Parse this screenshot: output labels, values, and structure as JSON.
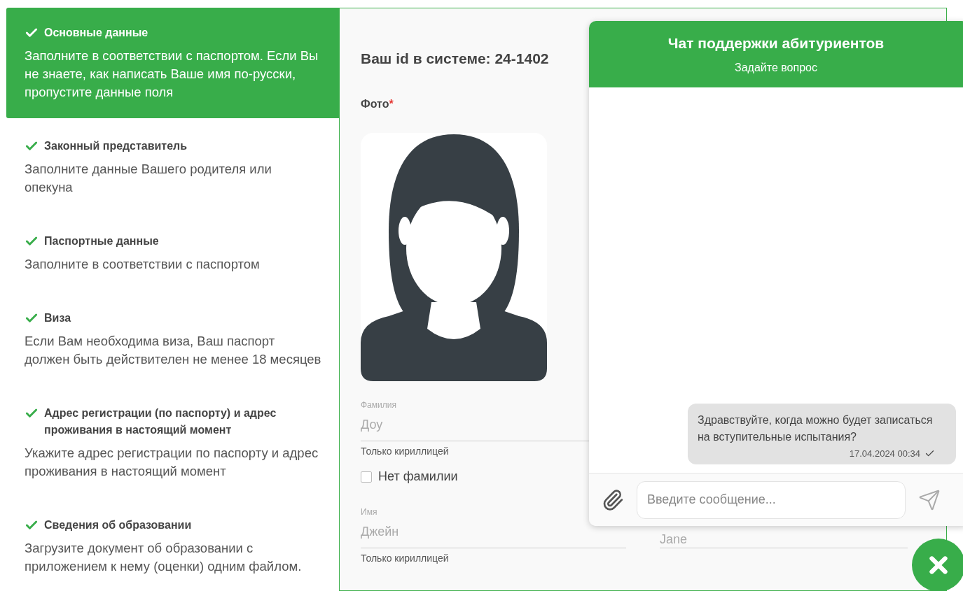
{
  "steps": [
    {
      "title": "Основные данные",
      "description": "Заполните в соответствии с паспортом. Если Вы не знаете, как написать Ваше имя по-русски, пропустите данные поля",
      "done": true,
      "selected": true
    },
    {
      "title": "Законный представитель",
      "description": "Заполните данные Вашего родителя или опекуна",
      "done": true,
      "selected": false
    },
    {
      "title": "Паспортные данные",
      "description": "Заполните в соответствии с паспортом",
      "done": true,
      "selected": false
    },
    {
      "title": "Виза",
      "description": "Если Вам необходима виза, Ваш паспорт должен быть действителен не менее 18 месяцев",
      "done": true,
      "selected": false
    },
    {
      "title": "Адрес регистрации (по паспорту) и адрес проживания в настоящий момент",
      "description": "Укажите адрес регистрации по паспорту и адрес проживания в настоящий момент",
      "done": true,
      "selected": false
    },
    {
      "title": "Сведения об образовании",
      "description": "Загрузите документ об образовании с приложением к нему (оценки) одним файлом.",
      "done": true,
      "selected": false
    }
  ],
  "form": {
    "id_heading": "Ваш id в системе: 24-1402",
    "photo": {
      "label": "Фото",
      "required": true,
      "required_mark": "*",
      "kind": "picture"
    },
    "last_name": {
      "label": "Фамилия",
      "placeholder": "Доу",
      "hint": "Только кириллицей"
    },
    "no_last_name": {
      "label": "Нет фамилии",
      "checked": false
    },
    "first_name": {
      "label": "Имя",
      "placeholder": "Джейн",
      "hint": "Только кириллицей"
    },
    "first_name_latin": {
      "placeholder": "Jane"
    }
  },
  "chat": {
    "title": "Чат поддержки абитуриентов",
    "subtitle": "Задайте вопрос",
    "messages": [
      {
        "text": "Здравствуйте, когда можно будет записаться на вступительные испытания?",
        "time": "17.04.2024 00:34",
        "delivered": true
      }
    ],
    "input": {
      "placeholder": "Введите сообщение..."
    },
    "open": true
  }
}
